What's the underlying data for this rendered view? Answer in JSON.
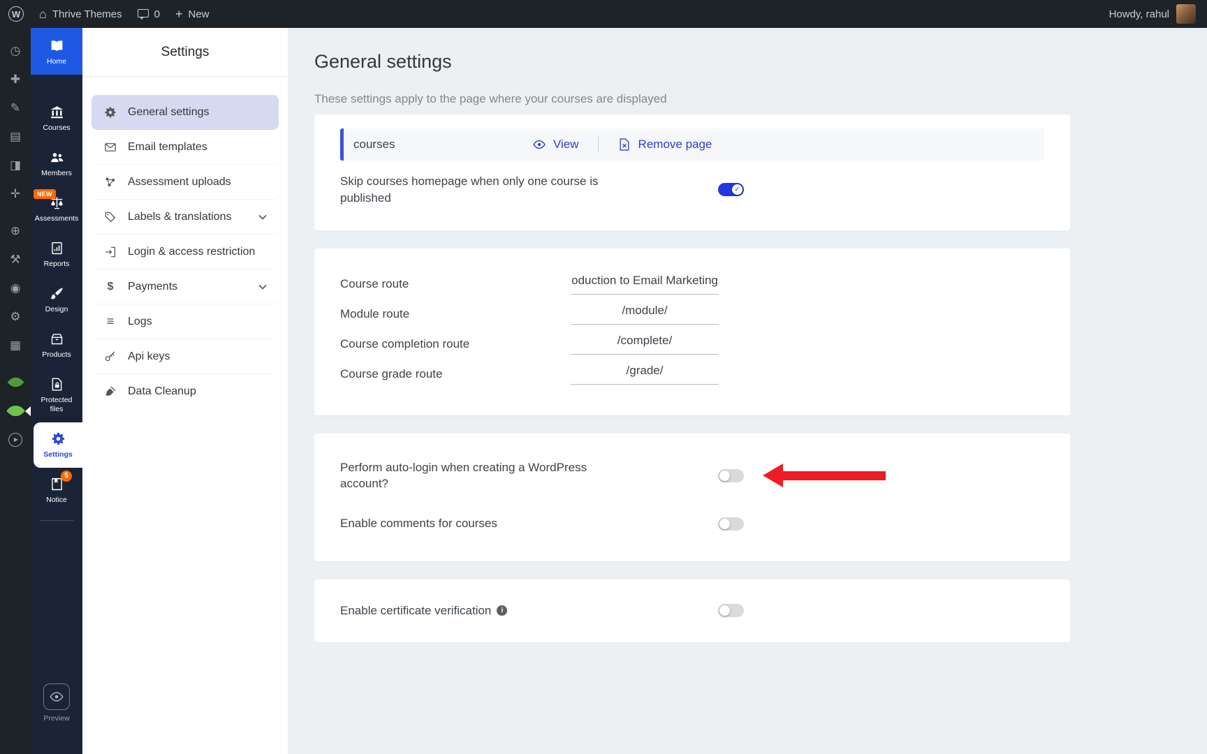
{
  "colors": {
    "accent_blue": "#2337de",
    "link_blue": "#2f3fd0",
    "arrow_red": "#ee1d23",
    "home_tile_blue": "#1d59e3",
    "badge_orange": "#ff6900",
    "selected_menu_bg": "#d6d9f1"
  },
  "admin_bar": {
    "wp_logo": "W",
    "site_name": "Thrive Themes",
    "comments_count": "0",
    "new_button": "New",
    "greeting": "Howdy, rahul"
  },
  "wp_strip": {
    "icons": [
      {
        "name": "dashboard",
        "glyph": "◷"
      },
      {
        "name": "media",
        "glyph": "✚"
      },
      {
        "name": "posts",
        "glyph": "✎"
      },
      {
        "name": "pages",
        "glyph": "▤"
      },
      {
        "name": "comments",
        "glyph": "◨"
      },
      {
        "name": "appearance",
        "glyph": "✛"
      },
      {
        "name": "plugins",
        "glyph": "⊕"
      },
      {
        "name": "tools",
        "glyph": "⚒"
      },
      {
        "name": "users",
        "glyph": "◉"
      },
      {
        "name": "settings",
        "glyph": "⚙"
      },
      {
        "name": "options",
        "glyph": "▦"
      }
    ],
    "video_glyph": "▶"
  },
  "app_sidebar": {
    "items": [
      {
        "label": "Home"
      },
      {
        "label": "Courses"
      },
      {
        "label": "Members"
      },
      {
        "label": "Assessments",
        "badge": "NEW"
      },
      {
        "label": "Reports"
      },
      {
        "label": "Design"
      },
      {
        "label": "Products"
      },
      {
        "label": "Protected files"
      },
      {
        "label": "Settings"
      },
      {
        "label": "Notice",
        "badge": "5"
      },
      {
        "label": "Preview"
      }
    ]
  },
  "settings_menu": {
    "title": "Settings",
    "items": [
      {
        "label": "General settings",
        "selected": true
      },
      {
        "label": "Email templates"
      },
      {
        "label": "Assessment uploads"
      },
      {
        "label": "Labels & translations",
        "expandable": true
      },
      {
        "label": "Login & access restriction"
      },
      {
        "label": "Payments",
        "expandable": true,
        "icon_glyph": "$"
      },
      {
        "label": "Logs",
        "icon_glyph": "≡"
      },
      {
        "label": "Api keys"
      },
      {
        "label": "Data Cleanup"
      }
    ]
  },
  "main": {
    "title": "General settings",
    "subtitle": "These settings apply to the page where your courses are displayed",
    "page_card": {
      "page_name": "courses",
      "view_label": "View",
      "remove_label": "Remove page",
      "skip_label": "Skip courses homepage when only one course is published",
      "skip_enabled": true
    },
    "routes": [
      {
        "label": "Course route",
        "value": "oduction to Email Marketing"
      },
      {
        "label": "Module route",
        "value": "/module/"
      },
      {
        "label": "Course completion route",
        "value": "/complete/"
      },
      {
        "label": "Course grade route",
        "value": "/grade/"
      }
    ],
    "login_card": {
      "rows": [
        {
          "label": "Perform auto-login when creating a WordPress account?",
          "enabled": false
        },
        {
          "label": "Enable comments for courses",
          "enabled": false
        }
      ]
    },
    "certificate_card": {
      "label": "Enable certificate verification",
      "enabled": false
    }
  }
}
